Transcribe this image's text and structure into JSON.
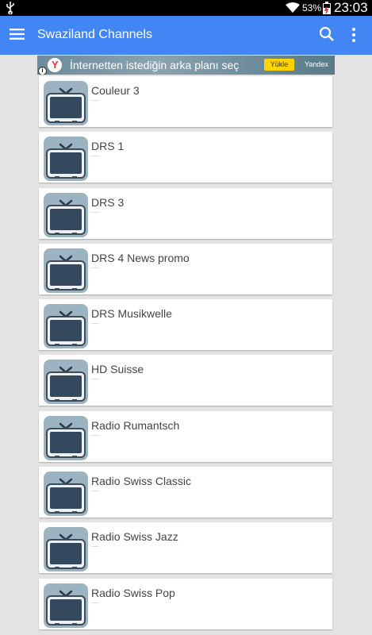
{
  "status_bar": {
    "battery_percent": "53%",
    "time": "23:03"
  },
  "app_bar": {
    "title": "Swaziland Channels"
  },
  "ad": {
    "text": "İnternetten istediğin arka planı seç",
    "button": "Yükle",
    "brand": "Yandex",
    "info": "i"
  },
  "channels": [
    {
      "name": "Couleur 3"
    },
    {
      "name": "DRS 1"
    },
    {
      "name": "DRS 3"
    },
    {
      "name": "DRS 4 News promo"
    },
    {
      "name": "DRS Musikwelle"
    },
    {
      "name": "HD Suisse"
    },
    {
      "name": "Radio Rumantsch"
    },
    {
      "name": "Radio Swiss Classic"
    },
    {
      "name": "Radio Swiss Jazz"
    },
    {
      "name": "Radio Swiss Pop"
    }
  ],
  "colors": {
    "app_bar": "#4285f4",
    "background": "#e3e3e3",
    "tv_frame": "#9cb3c2",
    "tv_screen": "#34495e"
  }
}
